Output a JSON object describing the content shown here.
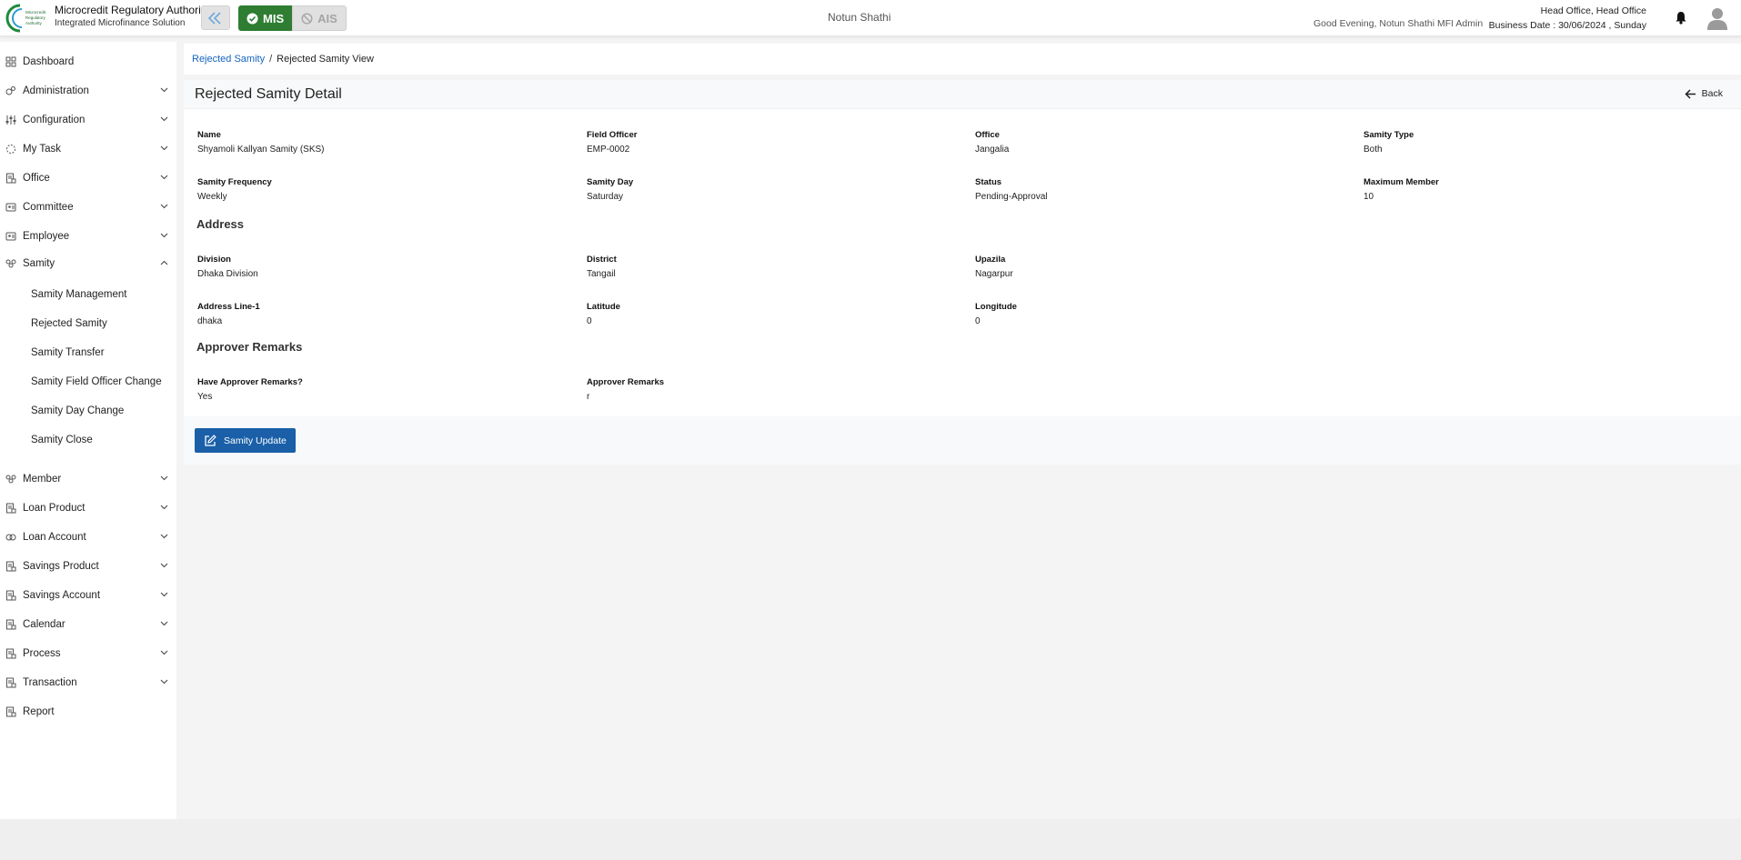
{
  "header": {
    "org_name": "Microcredit Regulatory Authority",
    "org_tagline": "Integrated Microfinance Solution",
    "logo_text": "Microcredit Regulatory Authority",
    "modes": [
      {
        "label": "MIS",
        "active": true
      },
      {
        "label": "AIS",
        "active": false
      }
    ],
    "center_title": "Notun Shathi",
    "greeting": "Good Evening, Notun Shathi MFI Admin",
    "office": "Head Office, Head Office",
    "business_date": "Business Date : 30/06/2024 , Sunday",
    "icons": {
      "collapse": "double-chevron-left-icon",
      "bell": "bell-icon",
      "avatar": "user-avatar-icon"
    },
    "colors": {
      "mis_active": "#2e7d32",
      "link": "#1565c0",
      "primary_button": "#1a5fa8"
    }
  },
  "sidebar": {
    "items": [
      {
        "label": "Dashboard",
        "icon": "grid-icon",
        "expandable": false
      },
      {
        "label": "Administration",
        "icon": "admin-icon",
        "expandable": true
      },
      {
        "label": "Configuration",
        "icon": "sliders-icon",
        "expandable": true
      },
      {
        "label": "My Task",
        "icon": "spinner-icon",
        "expandable": true
      },
      {
        "label": "Office",
        "icon": "document-icon",
        "expandable": true
      },
      {
        "label": "Committee",
        "icon": "committee-icon",
        "expandable": true
      },
      {
        "label": "Employee",
        "icon": "employee-icon",
        "expandable": true
      },
      {
        "label": "Samity",
        "icon": "group-icon",
        "expandable": true,
        "expanded": true
      }
    ],
    "samity_sub_items": [
      "Samity Management",
      "Rejected Samity",
      "Samity Transfer",
      "Samity Field Officer Change",
      "Samity Day Change",
      "Samity Close"
    ],
    "items_after": [
      {
        "label": "Member",
        "icon": "member-icon",
        "expandable": true
      },
      {
        "label": "Loan Product",
        "icon": "document-icon",
        "expandable": true
      },
      {
        "label": "Loan Account",
        "icon": "loan-account-icon",
        "expandable": true
      },
      {
        "label": "Savings Product",
        "icon": "document-icon",
        "expandable": true
      },
      {
        "label": "Savings Account",
        "icon": "document-icon",
        "expandable": true
      },
      {
        "label": "Calendar",
        "icon": "document-icon",
        "expandable": true
      },
      {
        "label": "Process",
        "icon": "document-icon",
        "expandable": true
      },
      {
        "label": "Transaction",
        "icon": "document-icon",
        "expandable": true
      },
      {
        "label": "Report",
        "icon": "document-icon",
        "expandable": false
      }
    ]
  },
  "breadcrumb": {
    "parent": "Rejected Samity",
    "separator": "/",
    "current": "Rejected Samity View"
  },
  "detail": {
    "title": "Rejected Samity Detail",
    "back_label": "Back",
    "fields_row1": [
      {
        "label": "Name",
        "value": "Shyamoli Kallyan Samity (SKS)"
      },
      {
        "label": "Field Officer",
        "value": "EMP-0002"
      },
      {
        "label": "Office",
        "value": "Jangalia"
      },
      {
        "label": "Samity Type",
        "value": "Both"
      }
    ],
    "fields_row2": [
      {
        "label": "Samity Frequency",
        "value": "Weekly"
      },
      {
        "label": "Samity Day",
        "value": "Saturday"
      },
      {
        "label": "Status",
        "value": "Pending-Approval"
      },
      {
        "label": "Maximum Member",
        "value": "10"
      }
    ],
    "address_title": "Address",
    "address_row1": [
      {
        "label": "Division",
        "value": "Dhaka Division"
      },
      {
        "label": "District",
        "value": "Tangail"
      },
      {
        "label": "Upazila",
        "value": "Nagarpur"
      }
    ],
    "address_row2": [
      {
        "label": "Address Line-1",
        "value": "dhaka"
      },
      {
        "label": "Latitude",
        "value": "0"
      },
      {
        "label": "Longitude",
        "value": "0"
      }
    ],
    "remarks_title": "Approver Remarks",
    "remarks_row": [
      {
        "label": "Have Approver Remarks?",
        "value": "Yes"
      },
      {
        "label": "Approver Remarks",
        "value": "r"
      }
    ],
    "update_button": "Samity Update"
  }
}
